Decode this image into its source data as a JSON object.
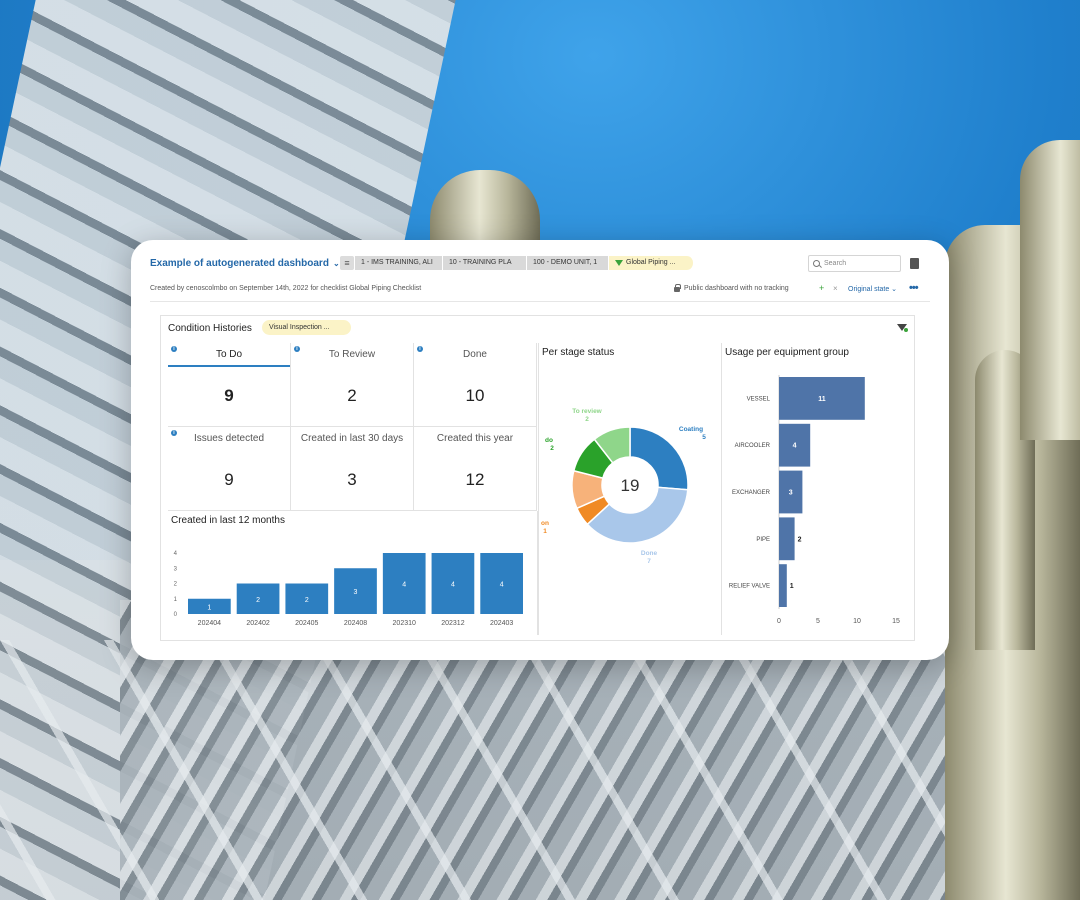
{
  "toolbar": {
    "dashboard_title": "Example of autogenerated dashboard",
    "chips": [
      "1 - IMS TRAINING, ALI",
      "10 - TRAINING PLA",
      "100 - DEMO UNIT, 1"
    ],
    "filter_chip": "Global Piping ...",
    "search_placeholder": "Search"
  },
  "subbar": {
    "created_by": "Created by cenoscolmbo on September 14th, 2022 for checklist Global Piping Checklist",
    "public_text": "Public dashboard with no tracking",
    "plus": "+",
    "close": "×",
    "original_state": "Original state ⌄",
    "more": "•••"
  },
  "panel": {
    "title": "Condition Histories",
    "chip": "Visual Inspection ..."
  },
  "kpis": [
    {
      "label": "To Do",
      "value": "9"
    },
    {
      "label": "To Review",
      "value": "2"
    },
    {
      "label": "Done",
      "value": "10"
    },
    {
      "label": "Issues detected",
      "value": "9"
    },
    {
      "label": "Created in last 30 days",
      "value": "3"
    },
    {
      "label": "Created this year",
      "value": "12"
    }
  ],
  "info_glyph": "i",
  "chart_data": [
    {
      "type": "bar",
      "title": "Created in last 12 months",
      "categories": [
        "202404",
        "202402",
        "202405",
        "202408",
        "202310",
        "202312",
        "202403"
      ],
      "values": [
        1,
        2,
        2,
        3,
        4,
        4,
        4
      ],
      "yticks": [
        "0",
        "1",
        "2",
        "3",
        "4"
      ],
      "ylim": [
        0,
        4
      ],
      "color": "#2d7fc1"
    },
    {
      "type": "pie",
      "title": "Per stage status",
      "center_label": "19",
      "slices": [
        {
          "label": "Coating",
          "value": "5",
          "amount": 5,
          "color": "#2d7fc1"
        },
        {
          "label": "Done",
          "value": "7",
          "amount": 7,
          "color": "#a9c7ea"
        },
        {
          "label": "on",
          "value": "1",
          "amount": 1,
          "color": "#f08a24"
        },
        {
          "label": "",
          "value": "",
          "amount": 2,
          "color": "#f7b27a"
        },
        {
          "label": "do",
          "value": "2",
          "amount": 2,
          "color": "#2aa22a"
        },
        {
          "label": "To review",
          "value": "2",
          "amount": 2,
          "color": "#8fd68a"
        }
      ]
    },
    {
      "type": "bar",
      "orientation": "horizontal",
      "title": "Usage per equipment group",
      "categories": [
        "VESSEL",
        "AIRCOOLER",
        "EXCHANGER",
        "PIPE",
        "RELIEF VALVE"
      ],
      "values": [
        11,
        4,
        3,
        2,
        1
      ],
      "xticks": [
        "0",
        "5",
        "10",
        "15"
      ],
      "xlim": [
        0,
        15
      ],
      "color": "#4f74a8"
    }
  ]
}
